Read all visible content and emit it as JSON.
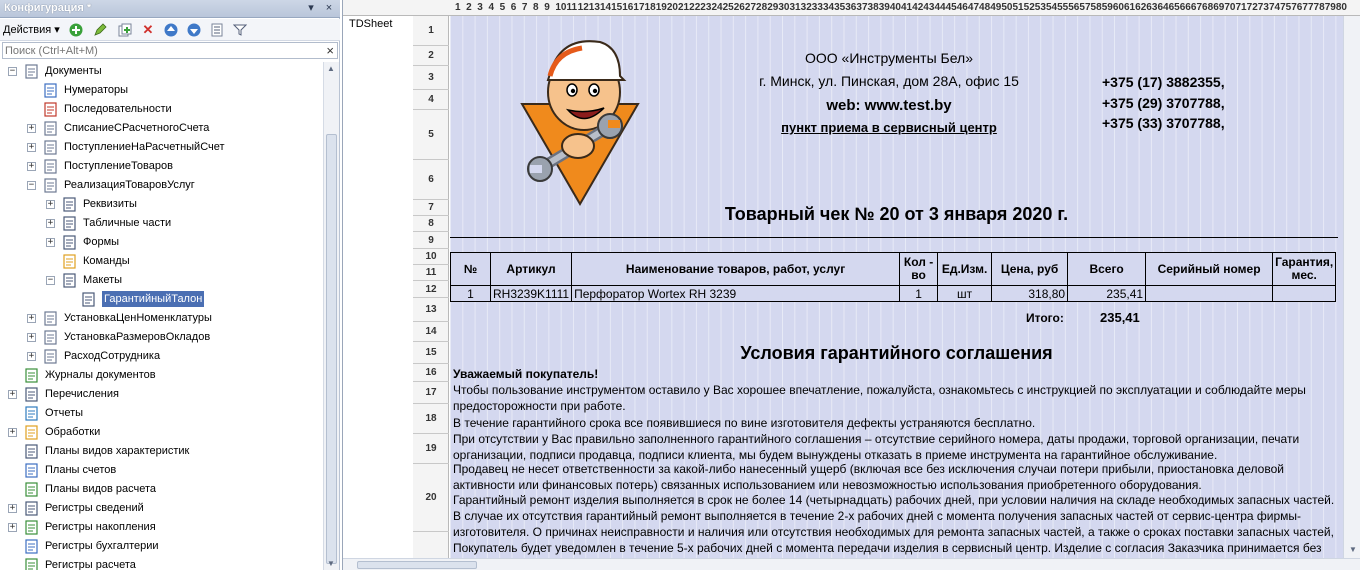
{
  "panel": {
    "title": "Конфигурация *",
    "actions_label": "Действия",
    "search_placeholder": "Поиск (Ctrl+Alt+M)",
    "icons": [
      "add-icon",
      "edit-icon",
      "copy-icon",
      "delete-icon",
      "move-up-icon",
      "move-down-icon",
      "list-icon",
      "filter-icon"
    ]
  },
  "tree": [
    {
      "label": "Документы",
      "icon": "document-group-icon",
      "toggle": "−"
    },
    {
      "label": "Нумераторы",
      "icon": "numerator-icon",
      "toggle": ""
    },
    {
      "label": "Последовательности",
      "icon": "sequence-icon",
      "toggle": ""
    },
    {
      "label": "СписаниеСРасчетногоСчета",
      "icon": "document-icon",
      "toggle": "+"
    },
    {
      "label": "ПоступлениеНаРасчетныйСчет",
      "icon": "document-icon",
      "toggle": "+"
    },
    {
      "label": "ПоступлениеТоваров",
      "icon": "document-icon",
      "toggle": "+"
    },
    {
      "label": "РеализацияТоваровУслуг",
      "icon": "document-icon",
      "toggle": "−"
    },
    {
      "label": "Реквизиты",
      "icon": "attribute-icon",
      "toggle": "+"
    },
    {
      "label": "Табличные части",
      "icon": "table-icon",
      "toggle": "+"
    },
    {
      "label": "Формы",
      "icon": "form-icon",
      "toggle": "+"
    },
    {
      "label": "Команды",
      "icon": "command-icon",
      "toggle": ""
    },
    {
      "label": "Макеты",
      "icon": "template-icon",
      "toggle": "−"
    },
    {
      "label": "ГарантийныйТалон",
      "icon": "template-icon",
      "toggle": "",
      "selected": true
    },
    {
      "label": "УстановкаЦенНоменклатуры",
      "icon": "document-icon",
      "toggle": "+"
    },
    {
      "label": "УстановкаРазмеровОкладов",
      "icon": "document-icon",
      "toggle": "+"
    },
    {
      "label": "РасходСотрудника",
      "icon": "document-icon",
      "toggle": "+"
    },
    {
      "label": "Журналы документов",
      "icon": "journal-icon",
      "toggle": ""
    },
    {
      "label": "Перечисления",
      "icon": "enum-icon",
      "toggle": "+"
    },
    {
      "label": "Отчеты",
      "icon": "report-icon",
      "toggle": ""
    },
    {
      "label": "Обработки",
      "icon": "processing-icon",
      "toggle": "+"
    },
    {
      "label": "Планы видов характеристик",
      "icon": "chart-of-characteristics-icon",
      "toggle": ""
    },
    {
      "label": "Планы счетов",
      "icon": "chart-of-accounts-icon",
      "toggle": ""
    },
    {
      "label": "Планы видов расчета",
      "icon": "calculation-types-icon",
      "toggle": ""
    },
    {
      "label": "Регистры сведений",
      "icon": "info-register-icon",
      "toggle": "+"
    },
    {
      "label": "Регистры накопления",
      "icon": "accumulation-register-icon",
      "toggle": "+"
    },
    {
      "label": "Регистры бухгалтерии",
      "icon": "accounting-register-icon",
      "toggle": ""
    },
    {
      "label": "Регистры расчета",
      "icon": "calculation-register-icon",
      "toggle": ""
    }
  ],
  "sheet": {
    "tab_label": "TDSheet",
    "col_headers": [
      "1",
      "2",
      "3",
      "4",
      "5",
      "6",
      "7",
      "8",
      "9",
      "10",
      "11",
      "12",
      "13",
      "14",
      "15",
      "16",
      "17",
      "18",
      "19",
      "20",
      "21",
      "22",
      "23",
      "24",
      "25",
      "26",
      "27",
      "28",
      "29",
      "30",
      "31",
      "32",
      "33",
      "34",
      "35",
      "36",
      "37",
      "38",
      "39",
      "40",
      "41",
      "42",
      "43",
      "44",
      "45",
      "46",
      "47",
      "48",
      "49",
      "50",
      "51",
      "52",
      "53",
      "54",
      "55",
      "56",
      "57",
      "58",
      "59",
      "60",
      "61",
      "62",
      "63",
      "64",
      "65",
      "66",
      "67",
      "68",
      "69",
      "70",
      "71",
      "72",
      "73",
      "74",
      "75",
      "76",
      "77",
      "78",
      "79",
      "80"
    ],
    "row_headers": [
      "1",
      "2",
      "3",
      "4",
      "5",
      "6",
      "7",
      "8",
      "9",
      "10",
      "11",
      "12",
      "13",
      "14",
      "15",
      "16",
      "17",
      "18",
      "19",
      "20"
    ]
  },
  "document": {
    "company": {
      "name": "ООО «Инструменты Бел»",
      "address": "г. Минск, ул. Пинская, дом 28А, офис 15",
      "web": "web: www.test.by",
      "service": "пункт приема в сервисный центр",
      "phones": [
        "+375 (17) 3882355,",
        "+375 (29) 3707788,",
        "+375 (33) 3707788,"
      ]
    },
    "receipt_title": "Товарный чек № 20 от 3 января 2020 г.",
    "table": {
      "headers": [
        "№",
        "Артикул",
        "Наименование товаров, работ, услуг",
        "Кол - во",
        "Ед.Изм.",
        "Цена, руб",
        "Всего",
        "Серийный номер",
        "Гарантия, мес."
      ],
      "rows": [
        [
          "1",
          "RH3239K1111",
          "Перфоратор Wortex RH 3239",
          "1",
          "шт",
          "318,80",
          "235,41",
          "",
          ""
        ]
      ]
    },
    "total_label": "Итого:",
    "total_value": "235,41",
    "warranty_title": "Условия гарантийного соглашения",
    "paragraphs": [
      "Уважаемый покупатель!",
      "Чтобы пользование инструментом оставило у Вас хорошее впечатление, пожалуйста, ознакомьтесь с инструкцией по эксплуатации и соблюдайте меры предосторожности при работе.",
      "В течение гарантийного срока все появившиеся по вине изготовителя дефекты устраняются бесплатно.",
      "При отсутствии у Вас правильно заполненного гарантийного соглашения – отсутствие серийного номера, даты продажи, торговой организации, печати организации, подписи продавца, подписи клиента, мы будем вынуждены отказать в приеме инструмента на гарантийное обслуживание.",
      "Продавец не несет ответственности за какой-либо нанесенный ущерб (включая все без исключения случаи потери прибыли, приостановка деловой активности или финансовых потерь) связанных использованием или невозможностью использования приобретенного оборудования.",
      "Гарантийный ремонт изделия выполняется в срок не более  14 (четырнадцать) рабочих дней, при условии наличия на складе необходимых запасных частей. В случае их отсутствия гарантийный ремонт выполняется в течение 2-х рабочих дней с момента получения запасных частей от сервис-центра фирмы-изготовителя. О причинах неисправности и наличия или отсутствия необходимых для ремонта запасных частей, а также о сроках поставки запасных частей, Покупатель будет уведомлен в течение 5-х рабочих дней с момента передачи изделия в сервисный центр. Изделие с согласия Заказчика принимается без разборки и проверки неисправностей, без проверки внутренних повреждений. Принадлежность к гарантийному"
    ]
  }
}
